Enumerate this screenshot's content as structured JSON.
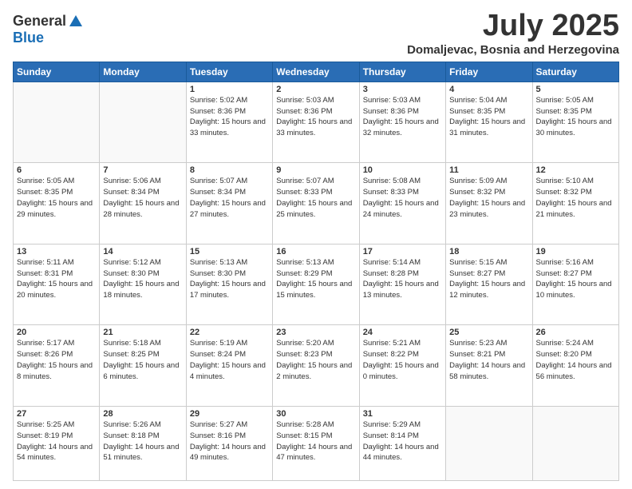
{
  "logo": {
    "general": "General",
    "blue": "Blue"
  },
  "title": "July 2025",
  "location": "Domaljevac, Bosnia and Herzegovina",
  "days_of_week": [
    "Sunday",
    "Monday",
    "Tuesday",
    "Wednesday",
    "Thursday",
    "Friday",
    "Saturday"
  ],
  "weeks": [
    [
      {
        "day": "",
        "info": ""
      },
      {
        "day": "",
        "info": ""
      },
      {
        "day": "1",
        "info": "Sunrise: 5:02 AM\nSunset: 8:36 PM\nDaylight: 15 hours and 33 minutes."
      },
      {
        "day": "2",
        "info": "Sunrise: 5:03 AM\nSunset: 8:36 PM\nDaylight: 15 hours and 33 minutes."
      },
      {
        "day": "3",
        "info": "Sunrise: 5:03 AM\nSunset: 8:36 PM\nDaylight: 15 hours and 32 minutes."
      },
      {
        "day": "4",
        "info": "Sunrise: 5:04 AM\nSunset: 8:35 PM\nDaylight: 15 hours and 31 minutes."
      },
      {
        "day": "5",
        "info": "Sunrise: 5:05 AM\nSunset: 8:35 PM\nDaylight: 15 hours and 30 minutes."
      }
    ],
    [
      {
        "day": "6",
        "info": "Sunrise: 5:05 AM\nSunset: 8:35 PM\nDaylight: 15 hours and 29 minutes."
      },
      {
        "day": "7",
        "info": "Sunrise: 5:06 AM\nSunset: 8:34 PM\nDaylight: 15 hours and 28 minutes."
      },
      {
        "day": "8",
        "info": "Sunrise: 5:07 AM\nSunset: 8:34 PM\nDaylight: 15 hours and 27 minutes."
      },
      {
        "day": "9",
        "info": "Sunrise: 5:07 AM\nSunset: 8:33 PM\nDaylight: 15 hours and 25 minutes."
      },
      {
        "day": "10",
        "info": "Sunrise: 5:08 AM\nSunset: 8:33 PM\nDaylight: 15 hours and 24 minutes."
      },
      {
        "day": "11",
        "info": "Sunrise: 5:09 AM\nSunset: 8:32 PM\nDaylight: 15 hours and 23 minutes."
      },
      {
        "day": "12",
        "info": "Sunrise: 5:10 AM\nSunset: 8:32 PM\nDaylight: 15 hours and 21 minutes."
      }
    ],
    [
      {
        "day": "13",
        "info": "Sunrise: 5:11 AM\nSunset: 8:31 PM\nDaylight: 15 hours and 20 minutes."
      },
      {
        "day": "14",
        "info": "Sunrise: 5:12 AM\nSunset: 8:30 PM\nDaylight: 15 hours and 18 minutes."
      },
      {
        "day": "15",
        "info": "Sunrise: 5:13 AM\nSunset: 8:30 PM\nDaylight: 15 hours and 17 minutes."
      },
      {
        "day": "16",
        "info": "Sunrise: 5:13 AM\nSunset: 8:29 PM\nDaylight: 15 hours and 15 minutes."
      },
      {
        "day": "17",
        "info": "Sunrise: 5:14 AM\nSunset: 8:28 PM\nDaylight: 15 hours and 13 minutes."
      },
      {
        "day": "18",
        "info": "Sunrise: 5:15 AM\nSunset: 8:27 PM\nDaylight: 15 hours and 12 minutes."
      },
      {
        "day": "19",
        "info": "Sunrise: 5:16 AM\nSunset: 8:27 PM\nDaylight: 15 hours and 10 minutes."
      }
    ],
    [
      {
        "day": "20",
        "info": "Sunrise: 5:17 AM\nSunset: 8:26 PM\nDaylight: 15 hours and 8 minutes."
      },
      {
        "day": "21",
        "info": "Sunrise: 5:18 AM\nSunset: 8:25 PM\nDaylight: 15 hours and 6 minutes."
      },
      {
        "day": "22",
        "info": "Sunrise: 5:19 AM\nSunset: 8:24 PM\nDaylight: 15 hours and 4 minutes."
      },
      {
        "day": "23",
        "info": "Sunrise: 5:20 AM\nSunset: 8:23 PM\nDaylight: 15 hours and 2 minutes."
      },
      {
        "day": "24",
        "info": "Sunrise: 5:21 AM\nSunset: 8:22 PM\nDaylight: 15 hours and 0 minutes."
      },
      {
        "day": "25",
        "info": "Sunrise: 5:23 AM\nSunset: 8:21 PM\nDaylight: 14 hours and 58 minutes."
      },
      {
        "day": "26",
        "info": "Sunrise: 5:24 AM\nSunset: 8:20 PM\nDaylight: 14 hours and 56 minutes."
      }
    ],
    [
      {
        "day": "27",
        "info": "Sunrise: 5:25 AM\nSunset: 8:19 PM\nDaylight: 14 hours and 54 minutes."
      },
      {
        "day": "28",
        "info": "Sunrise: 5:26 AM\nSunset: 8:18 PM\nDaylight: 14 hours and 51 minutes."
      },
      {
        "day": "29",
        "info": "Sunrise: 5:27 AM\nSunset: 8:16 PM\nDaylight: 14 hours and 49 minutes."
      },
      {
        "day": "30",
        "info": "Sunrise: 5:28 AM\nSunset: 8:15 PM\nDaylight: 14 hours and 47 minutes."
      },
      {
        "day": "31",
        "info": "Sunrise: 5:29 AM\nSunset: 8:14 PM\nDaylight: 14 hours and 44 minutes."
      },
      {
        "day": "",
        "info": ""
      },
      {
        "day": "",
        "info": ""
      }
    ]
  ]
}
